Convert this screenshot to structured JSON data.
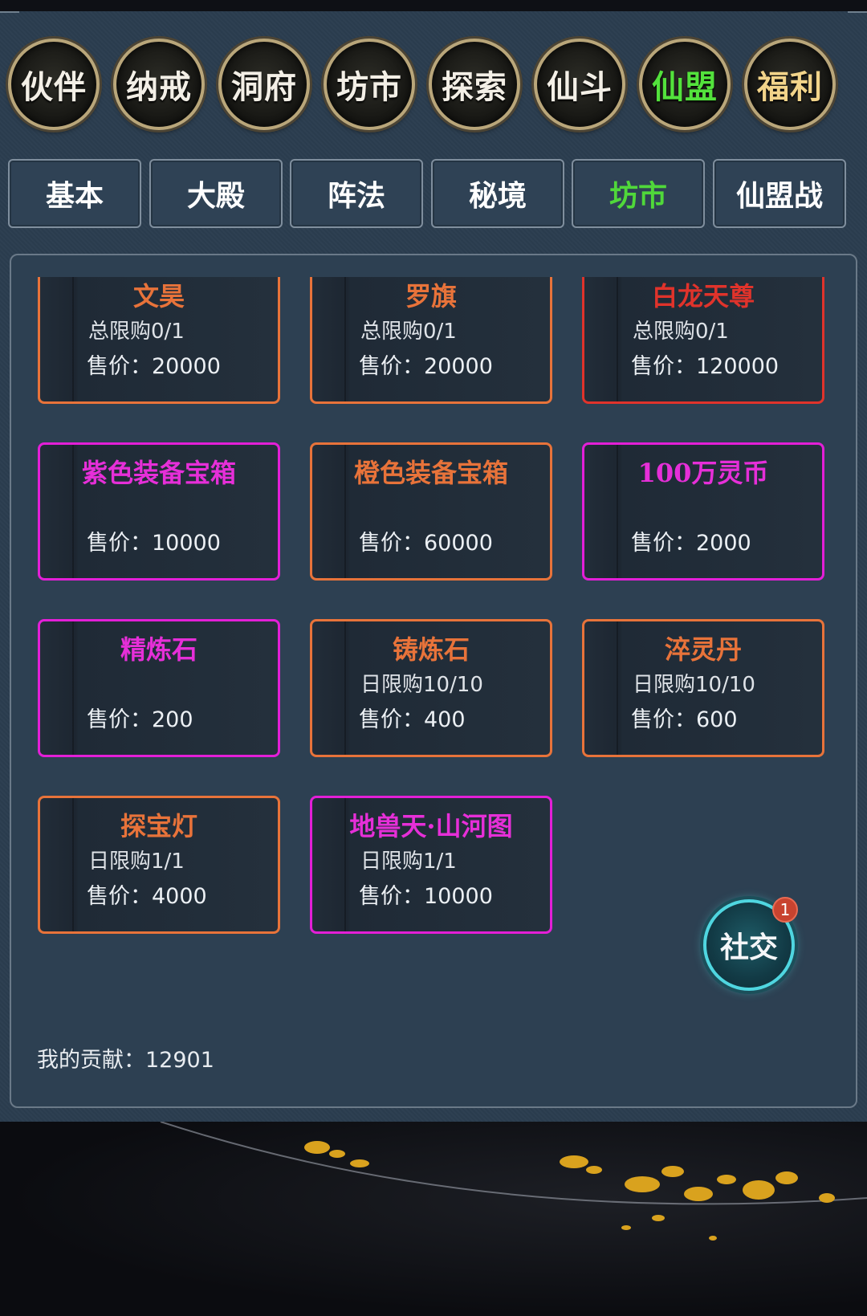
{
  "nav_circles": [
    {
      "label": "伙伴"
    },
    {
      "label": "纳戒"
    },
    {
      "label": "洞府"
    },
    {
      "label": "坊市"
    },
    {
      "label": "探索"
    },
    {
      "label": "仙斗"
    },
    {
      "label": "仙盟",
      "active": true
    },
    {
      "label": "福利"
    }
  ],
  "sub_tabs": [
    {
      "label": "基本"
    },
    {
      "label": "大殿"
    },
    {
      "label": "阵法"
    },
    {
      "label": "秘境"
    },
    {
      "label": "坊市",
      "active": true
    },
    {
      "label": "仙盟战"
    }
  ],
  "shop_items": [
    {
      "name": "文昊",
      "limit": "总限购0/1",
      "price": "售价：20000",
      "rarity_color": "#e8733a"
    },
    {
      "name": "罗旗",
      "limit": "总限购0/1",
      "price": "售价：20000",
      "rarity_color": "#e8733a"
    },
    {
      "name": "白龙天尊",
      "limit": "总限购0/1",
      "price": "售价：120000",
      "rarity_color": "#e0332b"
    },
    {
      "name": "紫色装备宝箱",
      "limit": "",
      "price": "售价：10000",
      "rarity_color": "#e31fd7"
    },
    {
      "name": "橙色装备宝箱",
      "limit": "",
      "price": "售价：60000",
      "rarity_color": "#e8733a"
    },
    {
      "name": "100万灵币",
      "limit": "",
      "price": "售价：2000",
      "rarity_color": "#e31fd7"
    },
    {
      "name": "精炼石",
      "limit": "",
      "price": "售价：200",
      "rarity_color": "#e31fd7"
    },
    {
      "name": "铸炼石",
      "limit": "日限购10/10",
      "price": "售价：400",
      "rarity_color": "#e8733a"
    },
    {
      "name": "淬灵丹",
      "limit": "日限购10/10",
      "price": "售价：600",
      "rarity_color": "#e8733a"
    },
    {
      "name": "探宝灯",
      "limit": "日限购1/1",
      "price": "售价：4000",
      "rarity_color": "#e8733a"
    },
    {
      "name": "地兽天·山河图",
      "limit": "日限购1/1",
      "price": "售价：10000",
      "rarity_color": "#e31fd7"
    }
  ],
  "contribution": "我的贡献：12901",
  "social": {
    "label": "社交",
    "badge": "1"
  },
  "colors": {
    "active_tab": "#50d83a",
    "orange": "#e8733a",
    "purple": "#e31fd7",
    "red": "#e0332b"
  }
}
